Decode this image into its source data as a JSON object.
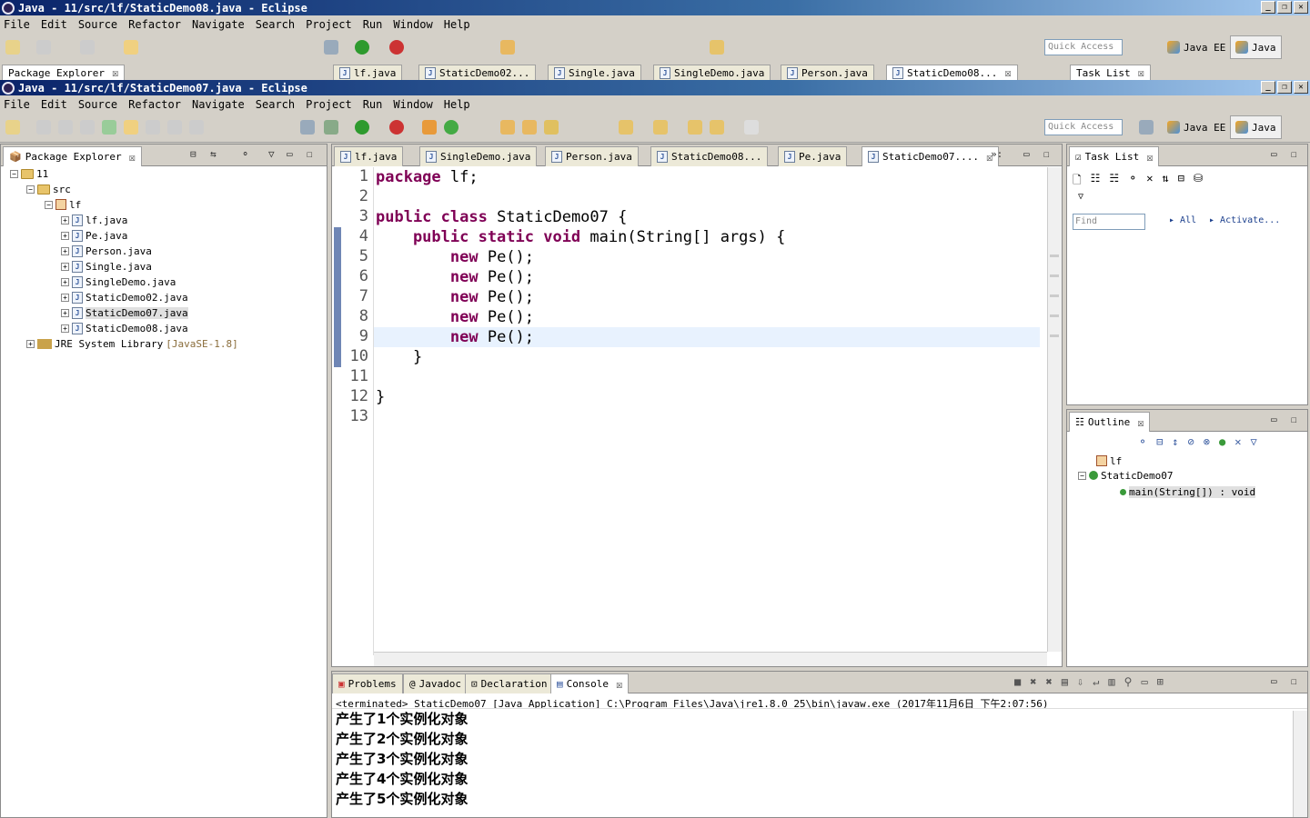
{
  "back_window": {
    "title": "Java - 11/src/lf/StaticDemo08.java - Eclipse",
    "menu": [
      "File",
      "Edit",
      "Source",
      "Refactor",
      "Navigate",
      "Search",
      "Project",
      "Run",
      "Window",
      "Help"
    ],
    "quick_access": "Quick Access",
    "persp_javaee": "Java EE",
    "persp_java": "Java",
    "package_explorer_tab": "Package Explorer",
    "editor_tabs": [
      "lf.java",
      "StaticDemo02...",
      "Single.java",
      "SingleDemo.java",
      "Person.java",
      "StaticDemo08..."
    ],
    "task_list_tab": "Task List"
  },
  "window": {
    "title": "Java - 11/src/lf/StaticDemo07.java - Eclipse",
    "menu": [
      "File",
      "Edit",
      "Source",
      "Refactor",
      "Navigate",
      "Search",
      "Project",
      "Run",
      "Window",
      "Help"
    ],
    "quick_access": "Quick Access",
    "persp_javaee": "Java EE",
    "persp_java": "Java"
  },
  "package_explorer": {
    "tab": "Package Explorer",
    "project": "11",
    "src": "src",
    "package": "lf",
    "files": [
      "lf.java",
      "Pe.java",
      "Person.java",
      "Single.java",
      "SingleDemo.java",
      "StaticDemo02.java",
      "StaticDemo07.java",
      "StaticDemo08.java"
    ],
    "jre": "JRE System Library",
    "jre_version": "[JavaSE-1.8]"
  },
  "editor": {
    "tabs": [
      "lf.java",
      "SingleDemo.java",
      "Person.java",
      "StaticDemo08...",
      "Pe.java",
      "StaticDemo07...."
    ],
    "overflow": "»:",
    "line_numbers": [
      "1",
      "2",
      "3",
      "4",
      "5",
      "6",
      "7",
      "8",
      "9",
      "10",
      "11",
      "12",
      "13"
    ],
    "lines": [
      {
        "kw": "package",
        "rest": " lf;"
      },
      {
        "kw": "",
        "rest": ""
      },
      {
        "kw": "public class",
        "rest": " StaticDemo07 {"
      },
      {
        "kw": "    public static void",
        "rest": " main(String[] args) {"
      },
      {
        "kw": "        new",
        "rest": " Pe();"
      },
      {
        "kw": "        new",
        "rest": " Pe();"
      },
      {
        "kw": "        new",
        "rest": " Pe();"
      },
      {
        "kw": "        new",
        "rest": " Pe();"
      },
      {
        "kw": "        new",
        "rest": " Pe();"
      },
      {
        "kw": "",
        "rest": "    }"
      },
      {
        "kw": "",
        "rest": ""
      },
      {
        "kw": "",
        "rest": "}"
      },
      {
        "kw": "",
        "rest": ""
      }
    ]
  },
  "task_list": {
    "tab": "Task List",
    "find_placeholder": "Find",
    "all": "All",
    "activate": "Activate..."
  },
  "outline": {
    "tab": "Outline",
    "package": "lf",
    "class": "StaticDemo07",
    "method": "main(String[]) : void"
  },
  "bottom": {
    "tabs": [
      "Problems",
      "Javadoc",
      "Declaration",
      "Console"
    ],
    "console_header": "<terminated> StaticDemo07 [Java Application] C:\\Program Files\\Java\\jre1.8.0_25\\bin\\javaw.exe (2017年11月6日 下午2:07:56)",
    "output": [
      "产生了1个实例化对象",
      "产生了2个实例化对象",
      "产生了3个实例化对象",
      "产生了4个实例化对象",
      "产生了5个实例化对象"
    ]
  },
  "colors": {
    "keyword": "#7f0055",
    "titlebar": "#0a246a",
    "current_line": "#e8f2fe"
  }
}
